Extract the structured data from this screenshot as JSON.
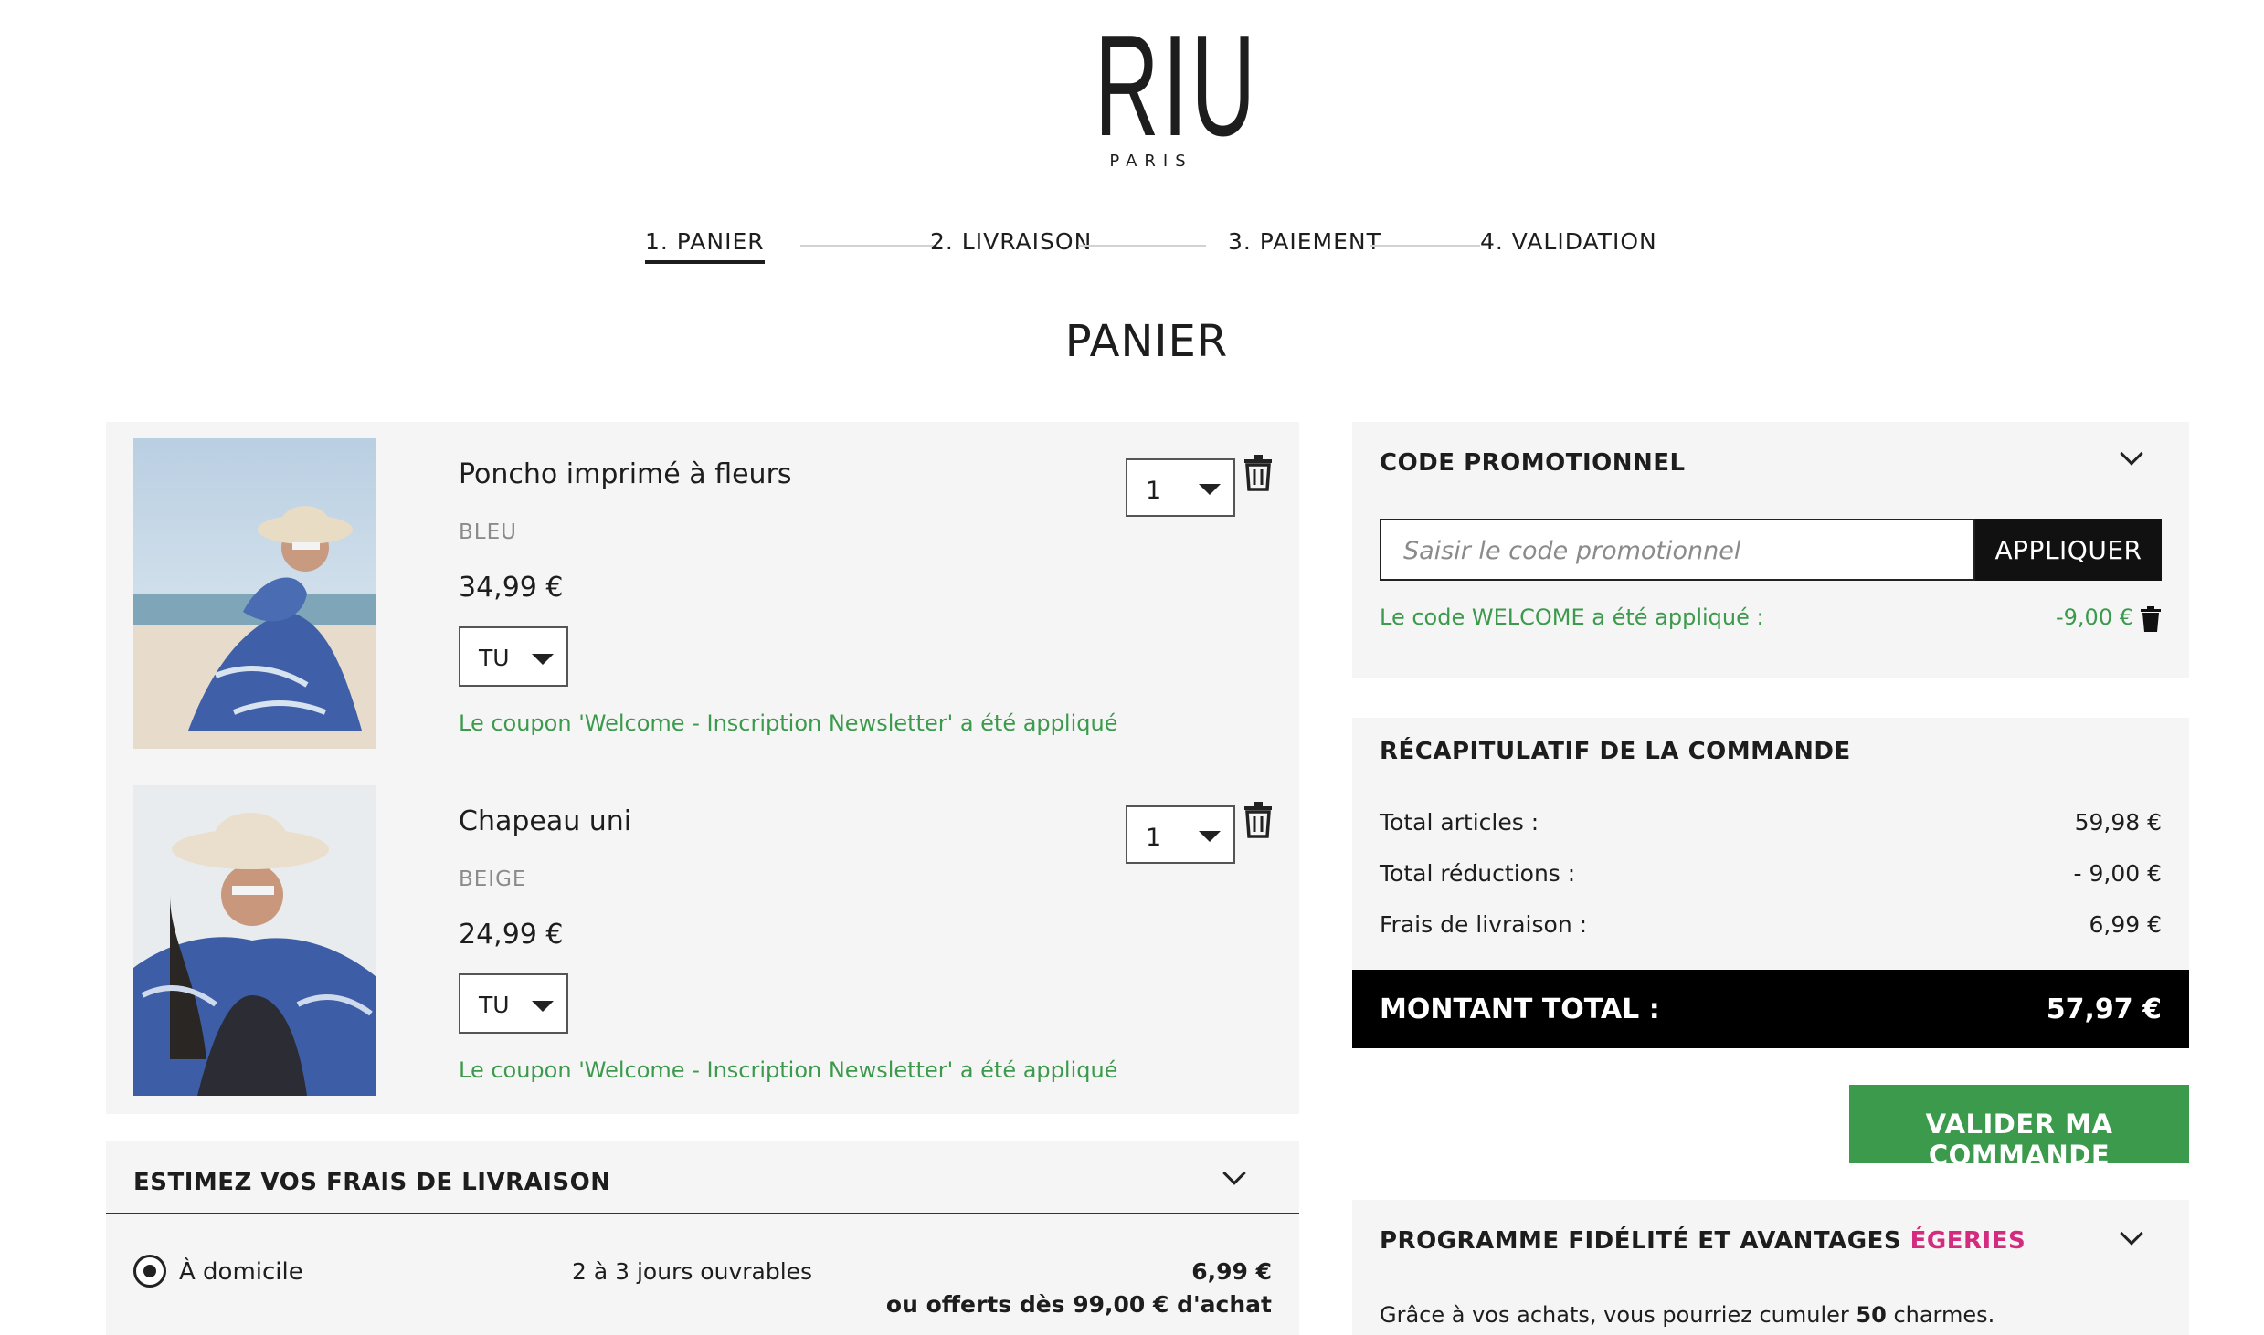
{
  "brand": {
    "name": "RIU",
    "sub": "PARIS"
  },
  "steps": [
    {
      "label": "1. PANIER"
    },
    {
      "label": "2. LIVRAISON"
    },
    {
      "label": "3. PAIEMENT"
    },
    {
      "label": "4. VALIDATION"
    }
  ],
  "page_title": "PANIER",
  "cart": {
    "items": [
      {
        "name": "Poncho imprimé à fleurs",
        "color": "BLEU",
        "price": "34,99 €",
        "size": "TU",
        "qty": "1",
        "coupon": "Le coupon 'Welcome - Inscription Newsletter' a été appliqué"
      },
      {
        "name": "Chapeau uni",
        "color": "BEIGE",
        "price": "24,99 €",
        "size": "TU",
        "qty": "1",
        "coupon": "Le coupon 'Welcome - Inscription Newsletter' a été appliqué"
      }
    ]
  },
  "shipping": {
    "title": "ESTIMEZ VOS FRAIS DE LIVRAISON",
    "option": "À domicile",
    "days": "2 à 3 jours ouvrables",
    "fee": "6,99 €",
    "free_note": "ou offerts dès 99,00 € d'achat"
  },
  "promo": {
    "title": "CODE PROMOTIONNEL",
    "placeholder": "Saisir le code promotionnel",
    "apply": "APPLIQUER",
    "applied_text": "Le code WELCOME a été appliqué :",
    "discount": "-9,00 €"
  },
  "recap": {
    "title": "RÉCAPITULATIF DE LA COMMANDE",
    "rows": [
      {
        "label": "Total articles :",
        "value": "59,98 €"
      },
      {
        "label": "Total réductions :",
        "value": "- 9,00 €"
      },
      {
        "label": "Frais de livraison :",
        "value": "6,99 €"
      }
    ],
    "total_label": "MONTANT TOTAL :",
    "total_value": "57,97 €"
  },
  "validate_button": "VALIDER MA COMMANDE",
  "loyalty": {
    "title": "PROGRAMME FIDÉLITÉ ET AVANTAGES",
    "highlight": "ÉGERIES",
    "desc_prefix": "Grâce à vos achats, vous pourriez cumuler",
    "desc_count": "50",
    "desc_suffix": "charmes."
  },
  "colors": {
    "green": "#3c9a4c",
    "pink": "#d42b7e",
    "black": "#000000",
    "panel": "#f5f5f5"
  }
}
